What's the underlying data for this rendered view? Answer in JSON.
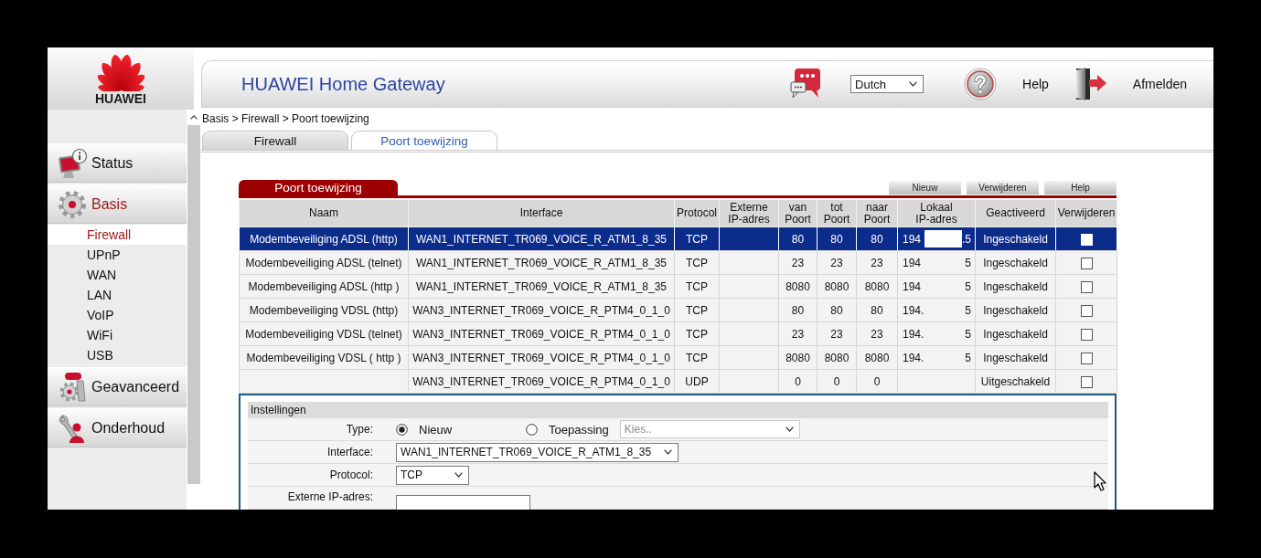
{
  "logo": {
    "text": "HUAWEI"
  },
  "header": {
    "title": "HUAWEI Home Gateway",
    "language": "Dutch",
    "actions": [
      {
        "kind": "help",
        "label": "Help"
      },
      {
        "kind": "logout",
        "label": "Afmelden"
      }
    ]
  },
  "breadcrumb": "Basis > Firewall > Poort toewijzing",
  "sidebar": {
    "items": [
      {
        "kind": "status",
        "label": "Status",
        "selected": false
      },
      {
        "kind": "basic",
        "label": "Basis",
        "selected": true,
        "children": [
          {
            "label": "Firewall",
            "selected": true
          },
          {
            "label": "UPnP",
            "selected": false
          },
          {
            "label": "WAN",
            "selected": false
          },
          {
            "label": "LAN",
            "selected": false
          },
          {
            "label": "VoIP",
            "selected": false
          },
          {
            "label": "WiFi",
            "selected": false
          },
          {
            "label": "USB",
            "selected": false
          }
        ]
      },
      {
        "kind": "advanced",
        "label": "Geavanceerd",
        "selected": false
      },
      {
        "kind": "maintenance",
        "label": "Onderhoud",
        "selected": false
      }
    ]
  },
  "tabs": [
    {
      "label": "Firewall",
      "selected": false
    },
    {
      "label": "Poort toewijzing",
      "selected": true
    }
  ],
  "panel": {
    "title": "Poort toewijzing",
    "buttons": [
      "Nieuw",
      "Verwijderen",
      "Help"
    ]
  },
  "table": {
    "columns": [
      "Naam",
      "Interface",
      "Protocol",
      "Externe IP-adres",
      "van Poort",
      "tot Poort",
      "naar Poort",
      "Lokaal IP-adres",
      "Geactiveerd",
      "Verwijderen"
    ],
    "rows": [
      {
        "selected": true,
        "naam": "Modembeveiliging ADSL (http)",
        "interface": "WAN1_INTERNET_TR069_VOICE_R_ATM1_8_35",
        "protocol": "TCP",
        "van_poort": "80",
        "tot_poort": "80",
        "naar_poort": "80",
        "lokaal_ip_start": "194",
        "lokaal_ip_end": ".5",
        "redacted": true,
        "geactiveerd": "Ingeschakeld",
        "checked": false
      },
      {
        "selected": false,
        "naam": "Modembeveiliging ADSL (telnet)",
        "interface": "WAN1_INTERNET_TR069_VOICE_R_ATM1_8_35",
        "protocol": "TCP",
        "van_poort": "23",
        "tot_poort": "23",
        "naar_poort": "23",
        "lokaal_ip_start": "194",
        "lokaal_ip_end": "5",
        "redacted": false,
        "geactiveerd": "Ingeschakeld",
        "checked": false
      },
      {
        "selected": false,
        "naam": "Modembeveiliging ADSL (http )",
        "interface": "WAN1_INTERNET_TR069_VOICE_R_ATM1_8_35",
        "protocol": "TCP",
        "van_poort": "8080",
        "tot_poort": "8080",
        "naar_poort": "8080",
        "lokaal_ip_start": "194",
        "lokaal_ip_end": "5",
        "redacted": false,
        "geactiveerd": "Ingeschakeld",
        "checked": false
      },
      {
        "selected": false,
        "naam": "Modembeveiliging VDSL (http)",
        "interface": "WAN3_INTERNET_TR069_VOICE_R_PTM4_0_1_0",
        "protocol": "TCP",
        "van_poort": "80",
        "tot_poort": "80",
        "naar_poort": "80",
        "lokaal_ip_start": "194.",
        "lokaal_ip_end": "5",
        "redacted": false,
        "geactiveerd": "Ingeschakeld",
        "checked": false
      },
      {
        "selected": false,
        "naam": "Modembeveiliging VDSL (telnet)",
        "interface": "WAN3_INTERNET_TR069_VOICE_R_PTM4_0_1_0",
        "protocol": "TCP",
        "van_poort": "23",
        "tot_poort": "23",
        "naar_poort": "23",
        "lokaal_ip_start": "194.",
        "lokaal_ip_end": "5",
        "redacted": false,
        "geactiveerd": "Ingeschakeld",
        "checked": false
      },
      {
        "selected": false,
        "naam": "Modembeveiliging VDSL ( http )",
        "interface": "WAN3_INTERNET_TR069_VOICE_R_PTM4_0_1_0",
        "protocol": "TCP",
        "van_poort": "8080",
        "tot_poort": "8080",
        "naar_poort": "8080",
        "lokaal_ip_start": "194.",
        "lokaal_ip_end": "5",
        "redacted": false,
        "geactiveerd": "Ingeschakeld",
        "checked": false
      },
      {
        "selected": false,
        "interface": "WAN3_INTERNET_TR069_VOICE_R_PTM4_0_1_0",
        "protocol": "UDP",
        "van_poort": "0",
        "tot_poort": "0",
        "naar_poort": "0",
        "geactiveerd": "Uitgeschakeld",
        "checked": false
      }
    ]
  },
  "settings": {
    "title": "Instellingen",
    "fields": [
      {
        "kind": "radio",
        "label": "Type:",
        "options": [
          {
            "label": "Nieuw",
            "selected": true
          },
          {
            "label": "Toepassing",
            "selected": false
          }
        ],
        "select": {
          "value": "Kies..",
          "disabled": true
        }
      },
      {
        "kind": "select",
        "label": "Interface:",
        "value": "WAN1_INTERNET_TR069_VOICE_R_ATM1_8_35"
      },
      {
        "kind": "select",
        "label": "Protocol:",
        "value": "TCP"
      },
      {
        "kind": "text",
        "label": "Externe IP-adres:"
      }
    ]
  }
}
